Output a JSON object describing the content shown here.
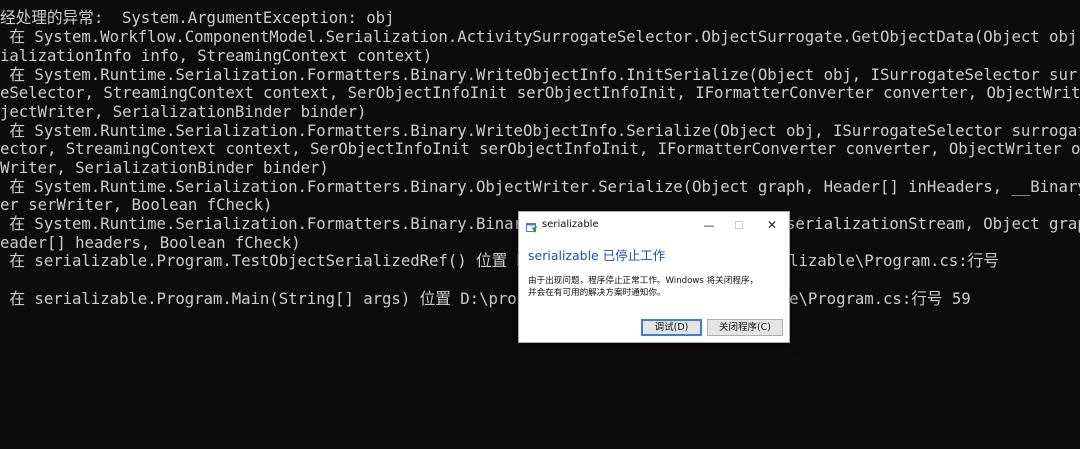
{
  "console": {
    "lines": [
      "经处理的异常:  System.ArgumentException: obj",
      " 在 System.Workflow.ComponentModel.Serialization.ActivitySurrogateSelector.ObjectSurrogate.GetObjectData(Object obj, ",
      "ializationInfo info, StreamingContext context)",
      " 在 System.Runtime.Serialization.Formatters.Binary.WriteObjectInfo.InitSerialize(Object obj, ISurrogateSelector surr",
      "eSelector, StreamingContext context, SerObjectInfoInit serObjectInfoInit, IFormatterConverter converter, ObjectWrite",
      "jectWriter, SerializationBinder binder)",
      " 在 System.Runtime.Serialization.Formatters.Binary.WriteObjectInfo.Serialize(Object obj, ISurrogateSelector surrogat",
      "ector, StreamingContext context, SerObjectInfoInit serObjectInfoInit, IFormatterConverter converter, ObjectWriter ob",
      "Writer, SerializationBinder binder)",
      " 在 System.Runtime.Serialization.Formatters.Binary.ObjectWriter.Serialize(Object graph, Header[] inHeaders, __Binary",
      "er serWriter, Boolean fCheck)",
      " 在 System.Runtime.Serialization.Formatters.Binary.BinaryFormatter.Serialize(Stream serializationStream, Object grap",
      "eader[] headers, Boolean fCheck)",
      " 在 serializable.Program.TestObjectSerializedRef() 位置 D:\\project\\serializable\\serializable\\Program.cs:行号 ",
      "",
      " 在 serializable.Program.Main(String[] args) 位置 D:\\project\\serializable\\serializable\\Program.cs:行号 59"
    ]
  },
  "dialog": {
    "title": "serializable",
    "minimize_glyph": "—",
    "maximize_glyph": "☐",
    "close_glyph": "✕",
    "main_instruction": "serializable 已停止工作",
    "content_line1": "由于出现问题，程序停止正常工作。Windows 将关闭程序，",
    "content_line2": "并会在有可用的解决方案时通知你。",
    "debug_button": "调试(D)",
    "close_program_button": "关闭程序(C)",
    "icon": "app-window-icon",
    "accent_color": "#1f4fa3"
  }
}
